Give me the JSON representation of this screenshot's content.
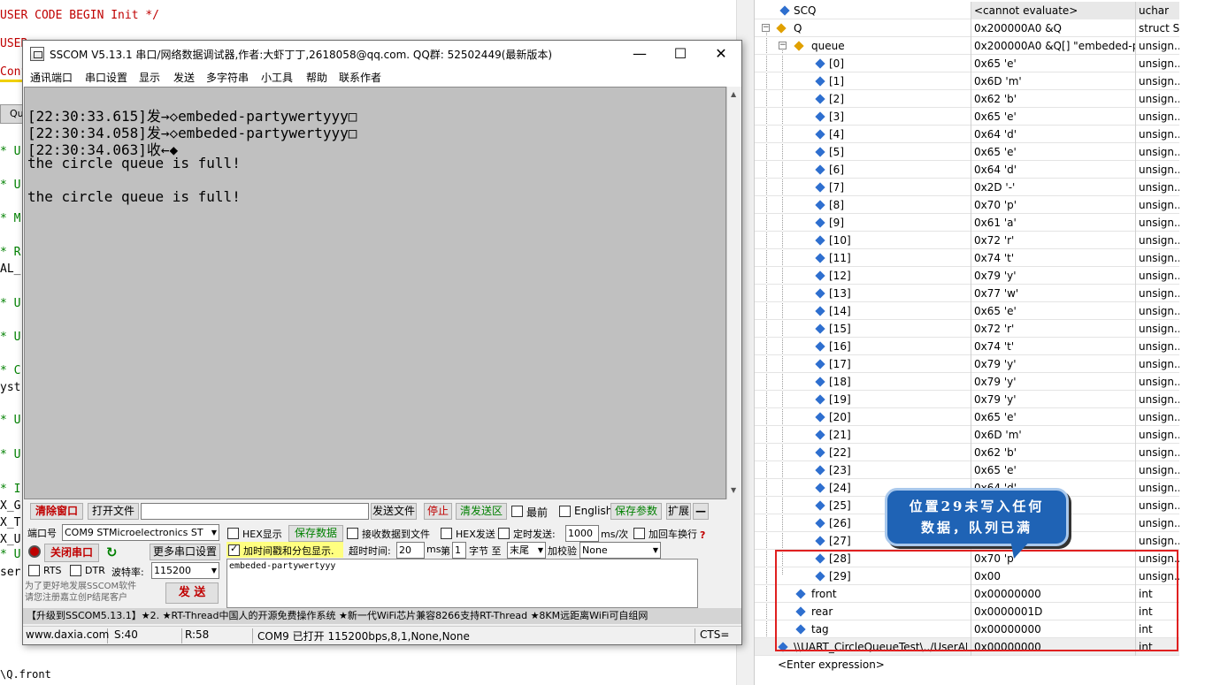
{
  "editor": {
    "lines": [
      {
        "text": "USER CODE BEGIN Init */",
        "cls": "red"
      },
      {
        "text": "USER",
        "cls": "red"
      },
      {
        "text": "Conf",
        "cls": "red"
      },
      {
        "text": "* U",
        "cls": "green"
      },
      {
        "text": "* U",
        "cls": "green"
      },
      {
        "text": "* M",
        "cls": "green"
      },
      {
        "text": "* R",
        "cls": "green"
      },
      {
        "text": "AL_",
        "cls": "black"
      },
      {
        "text": "* U",
        "cls": "green"
      },
      {
        "text": "* U",
        "cls": "green"
      },
      {
        "text": "* C",
        "cls": "green"
      },
      {
        "text": "yst",
        "cls": "black"
      },
      {
        "text": "* U",
        "cls": "green"
      },
      {
        "text": "* U",
        "cls": "green"
      },
      {
        "text": "* I",
        "cls": "green"
      },
      {
        "text": "X_G",
        "cls": "black"
      },
      {
        "text": "X_T",
        "cls": "black"
      },
      {
        "text": "X_U",
        "cls": "black"
      },
      {
        "text": "* U",
        "cls": "green"
      },
      {
        "text": "ser",
        "cls": "black"
      }
    ],
    "tab_label": "Qu",
    "bottom_text": "\\Q.front"
  },
  "sscom": {
    "title": "SSCOM V5.13.1 串口/网络数据调试器,作者:大虾丁丁,2618058@qq.com. QQ群: 52502449(最新版本)",
    "window_buttons": {
      "minimize": "—",
      "maximize": "☐",
      "close": "✕"
    },
    "menu": [
      "通讯端口",
      "串口设置",
      "显示",
      "发送",
      "多字符串",
      "小工具",
      "帮助",
      "联系作者"
    ],
    "receive_lines": [
      "[22:30:33.615]发→◇embeded-partywertyyy□",
      "[22:30:34.058]发→◇embeded-partywertyyy□",
      "[22:30:34.063]收←◆",
      "the circle queue is full!",
      "",
      "the circle queue is full!"
    ],
    "toolbar1": {
      "clear": "清除窗口",
      "open_file": "打开文件",
      "send_file": "发送文件",
      "stop": "停止",
      "clear_send": "清发送区",
      "topmost": "最前",
      "english": "English",
      "save_params": "保存参数",
      "expand": "扩展",
      "collapse": "—"
    },
    "port": {
      "label": "端口号",
      "value": "COM9 STMicroelectronics ST",
      "close_port": "关闭串口",
      "more_settings": "更多串口设置",
      "rts": "RTS",
      "dtr": "DTR",
      "baud_label": "波特率:",
      "baud": "115200"
    },
    "options": {
      "hex_display": "HEX显示",
      "save_data": "保存数据",
      "recv_to_file": "接收数据到文件",
      "hex_send": "HEX发送",
      "timed_send": "定时发送:",
      "timed_ms": "1000",
      "ms_unit": "ms/次",
      "crlf": "加回车换行",
      "timestamp": "加时间戳和分包显示.",
      "timeout_label": "超时时间:",
      "timeout": "20",
      "ms": "ms",
      "byte_prefix": "第",
      "byte_index": "1",
      "byte_unit": "字节 至",
      "byte_end": "末尾",
      "checksum_label": "加校验",
      "checksum": "None"
    },
    "send_text": "embeded-partywertyyy",
    "send_button": "发 送",
    "promo": "为了更好地发展SSCOM软件\n请您注册嘉立创P结尾客户",
    "ticker": "【升级到SSCOM5.13.1】★2. ★RT-Thread中国人的开源免费操作系统 ★新一代WiFi芯片兼容8266支持RT-Thread ★8KM远距离WiFi可自组网",
    "status": {
      "site": "www.daxia.com",
      "s": "S:40",
      "r": "R:58",
      "port": "COM9 已打开  115200bps,8,1,None,None",
      "cts": "CTS="
    }
  },
  "watch": {
    "scq": {
      "name": "SCQ",
      "value": "<cannot evaluate>",
      "type": "uchar"
    },
    "q": {
      "name": "Q",
      "value": "0x200000A0 &Q",
      "type": "struct S..."
    },
    "queue": {
      "name": "queue",
      "value": "0x200000A0 &Q[] \"embeded-pa...",
      "type": "unsign..."
    },
    "elements": [
      {
        "idx": "[0]",
        "value": "0x65 'e'"
      },
      {
        "idx": "[1]",
        "value": "0x6D 'm'"
      },
      {
        "idx": "[2]",
        "value": "0x62 'b'"
      },
      {
        "idx": "[3]",
        "value": "0x65 'e'"
      },
      {
        "idx": "[4]",
        "value": "0x64 'd'"
      },
      {
        "idx": "[5]",
        "value": "0x65 'e'"
      },
      {
        "idx": "[6]",
        "value": "0x64 'd'"
      },
      {
        "idx": "[7]",
        "value": "0x2D '-'"
      },
      {
        "idx": "[8]",
        "value": "0x70 'p'"
      },
      {
        "idx": "[9]",
        "value": "0x61 'a'"
      },
      {
        "idx": "[10]",
        "value": "0x72 'r'"
      },
      {
        "idx": "[11]",
        "value": "0x74 't'"
      },
      {
        "idx": "[12]",
        "value": "0x79 'y'"
      },
      {
        "idx": "[13]",
        "value": "0x77 'w'"
      },
      {
        "idx": "[14]",
        "value": "0x65 'e'"
      },
      {
        "idx": "[15]",
        "value": "0x72 'r'"
      },
      {
        "idx": "[16]",
        "value": "0x74 't'"
      },
      {
        "idx": "[17]",
        "value": "0x79 'y'"
      },
      {
        "idx": "[18]",
        "value": "0x79 'y'"
      },
      {
        "idx": "[19]",
        "value": "0x79 'y'"
      },
      {
        "idx": "[20]",
        "value": "0x65 'e'"
      },
      {
        "idx": "[21]",
        "value": "0x6D 'm'"
      },
      {
        "idx": "[22]",
        "value": "0x62 'b'"
      },
      {
        "idx": "[23]",
        "value": "0x65 'e'"
      },
      {
        "idx": "[24]",
        "value": "0x64 'd'"
      },
      {
        "idx": "[25]",
        "value": "0x65 'e'"
      },
      {
        "idx": "[26]",
        "value": "0x64 'd'"
      },
      {
        "idx": "[27]",
        "value": "0x2D '-'"
      },
      {
        "idx": "[28]",
        "value": "0x70 'p'"
      },
      {
        "idx": "[29]",
        "value": "0x00"
      }
    ],
    "element_type": "unsign...",
    "fields": [
      {
        "name": "front",
        "value": "0x00000000",
        "type": "int"
      },
      {
        "name": "rear",
        "value": "0x0000001D",
        "type": "int"
      },
      {
        "name": "tag",
        "value": "0x00000000",
        "type": "int"
      },
      {
        "name": "\\\\UART_CircleQueueTest\\../UserAP...",
        "value": "0x00000000",
        "type": "int"
      }
    ],
    "enter_expression": "<Enter expression>",
    "callout_line1": "位置29未写入任何",
    "callout_line2": "数据，队列已满",
    "accent_color": "#1f63b5",
    "highlight_color": "#e02020"
  }
}
